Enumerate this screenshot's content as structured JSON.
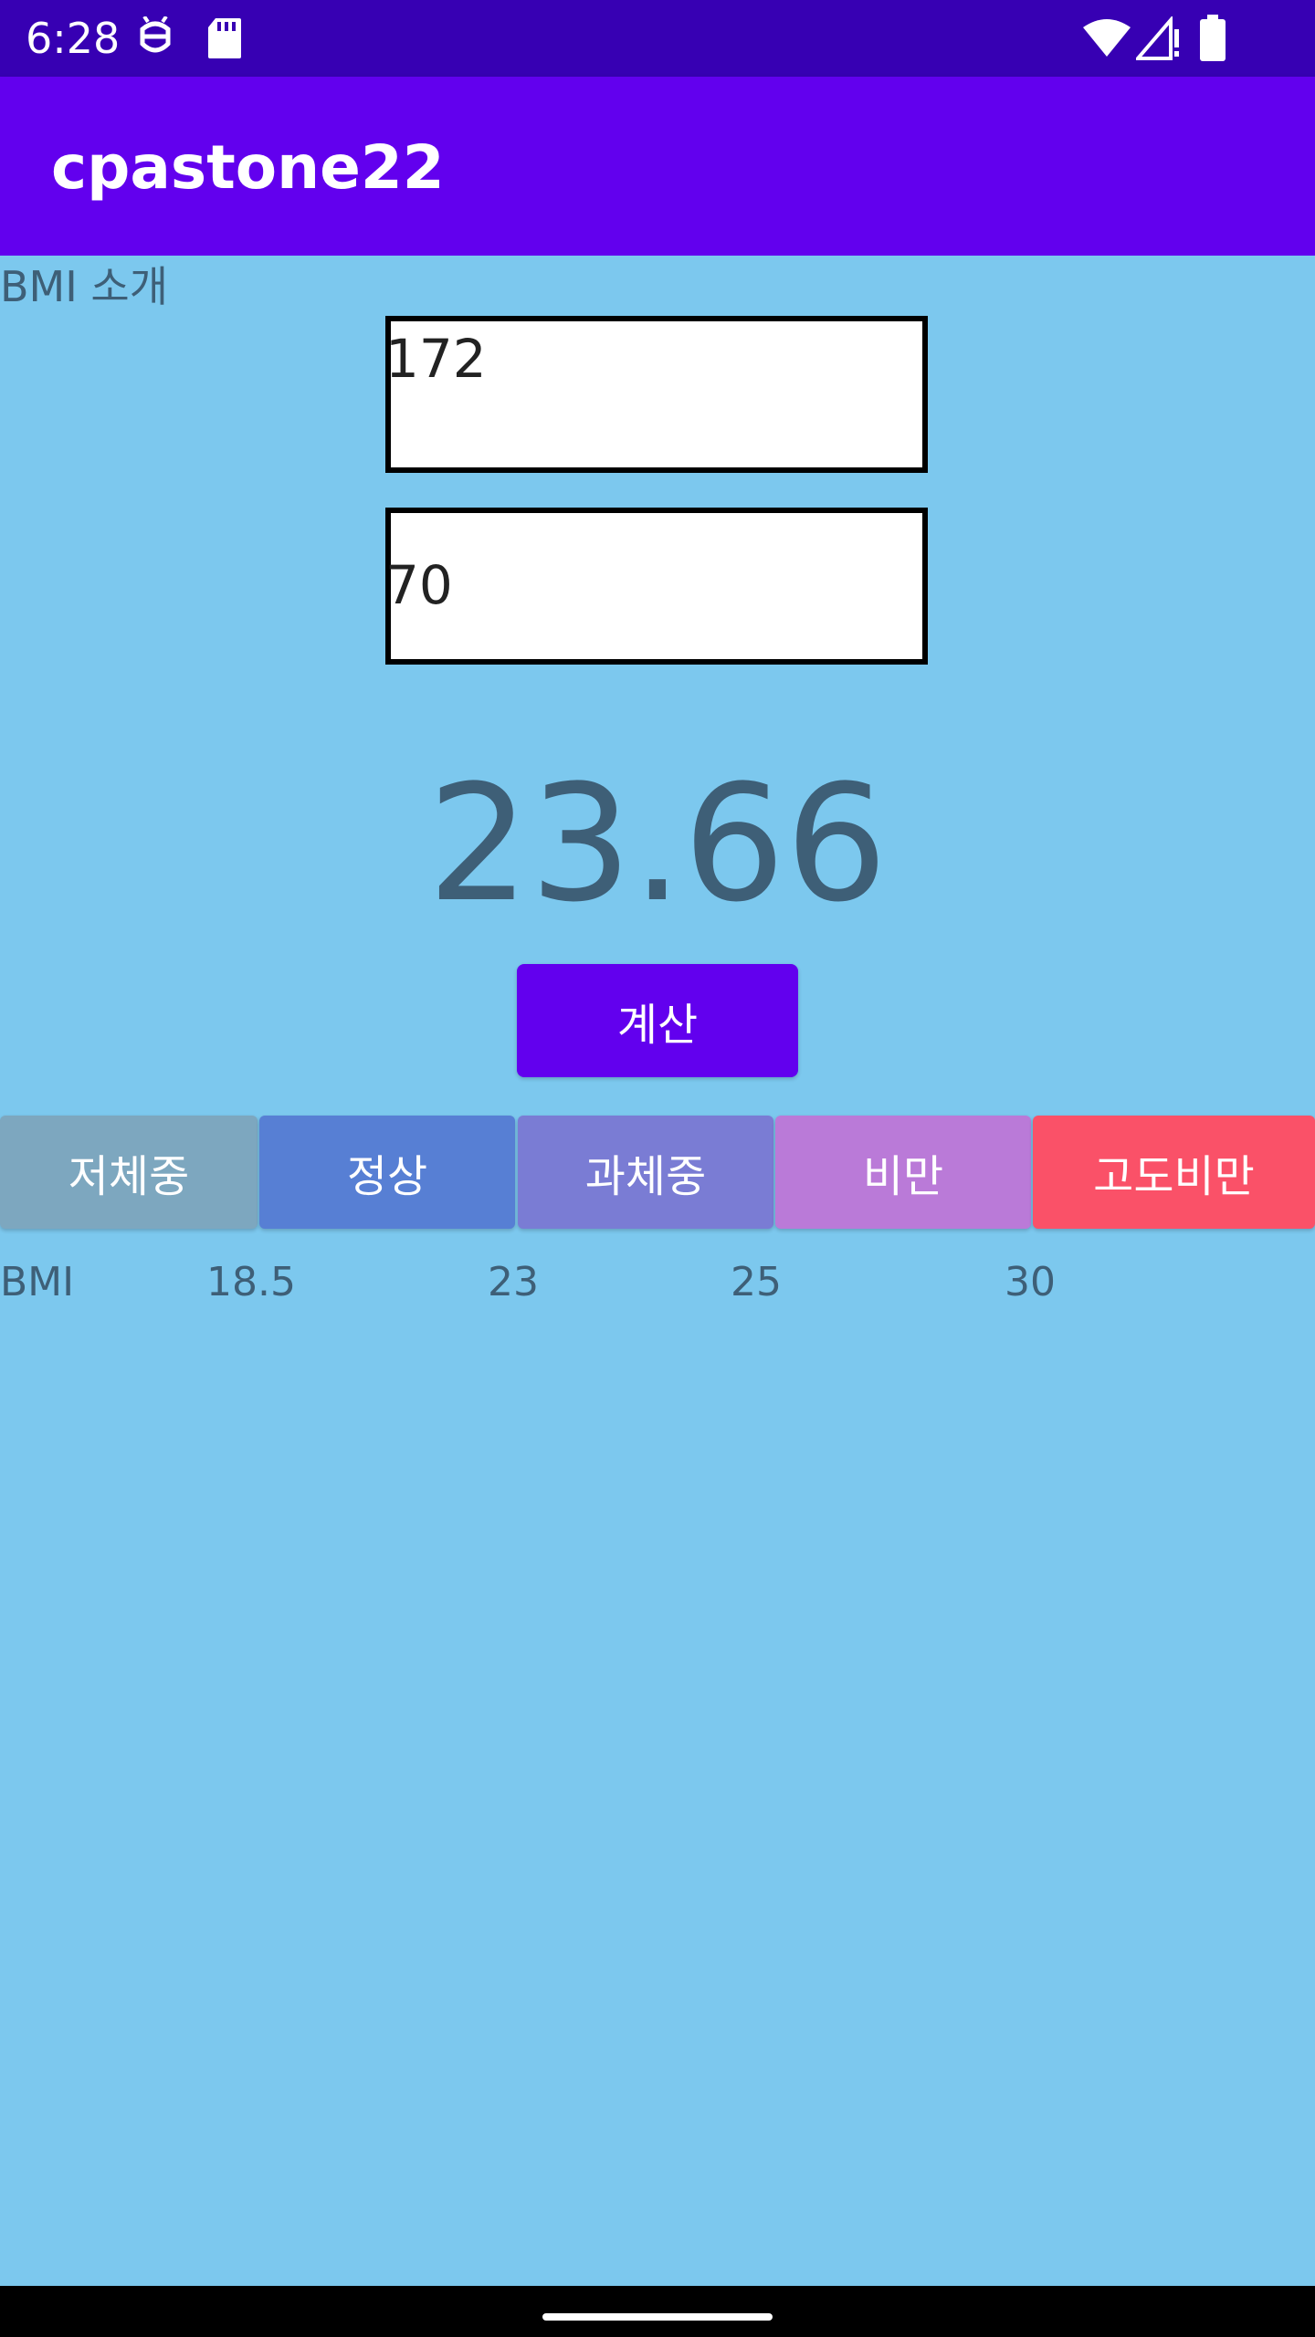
{
  "status_bar": {
    "time": "6:28",
    "left_icons": [
      "robot-icon",
      "sd-card-icon"
    ],
    "right_icons": [
      "wifi-icon",
      "signal-icon",
      "battery-icon"
    ]
  },
  "app_bar": {
    "title": "cpastone22"
  },
  "main": {
    "intro_link": "BMI 소개",
    "height_value": "172",
    "weight_value": "70",
    "bmi_result": "23.66",
    "calculate_label": "계산",
    "categories": [
      {
        "label": "저체중",
        "color": "#7DA7BF"
      },
      {
        "label": "정상",
        "color": "#577FD4"
      },
      {
        "label": "과체중",
        "color": "#7A7CD4"
      },
      {
        "label": "비만",
        "color": "#BA7AD8"
      },
      {
        "label": "고도비만",
        "color": "#FA5168"
      }
    ],
    "scale": {
      "label": "BMI",
      "thresholds": [
        "18.5",
        "23",
        "25",
        "30"
      ]
    }
  },
  "colors": {
    "status_bar": "#3700B3",
    "app_bar": "#6200EE",
    "background": "#7CC8EE",
    "text_muted": "#3E5F77"
  }
}
